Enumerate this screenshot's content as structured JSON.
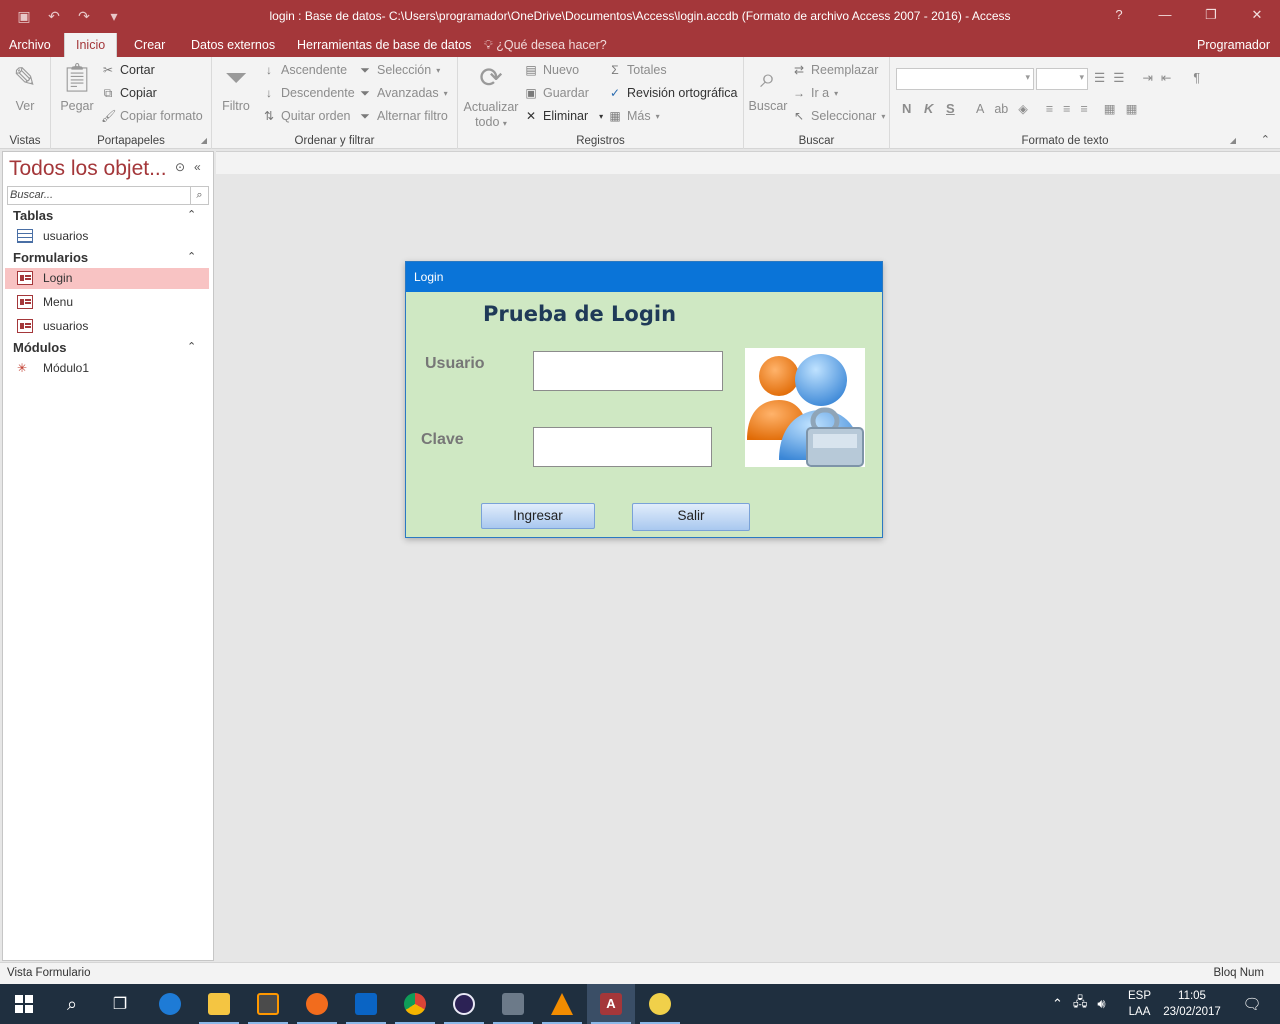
{
  "window": {
    "title": "login : Base de datos- C:\\Users\\programador\\OneDrive\\Documentos\\Access\\login.accdb (Formato de archivo Access 2007 - 2016) - Access"
  },
  "tabs": [
    "Archivo",
    "Inicio",
    "Crear",
    "Datos externos",
    "Herramientas de base de datos"
  ],
  "tell_me": "¿Qué desea hacer?",
  "user": "Programador",
  "ribbon": {
    "vistas": {
      "ver": "Ver",
      "label": "Vistas"
    },
    "portapapeles": {
      "pegar": "Pegar",
      "cortar": "Cortar",
      "copiar": "Copiar",
      "copiar_formato": "Copiar formato",
      "label": "Portapapeles"
    },
    "ordenar": {
      "filtro": "Filtro",
      "ascendente": "Ascendente",
      "descendente": "Descendente",
      "quitar_orden": "Quitar orden",
      "seleccion": "Selección",
      "avanzadas": "Avanzadas",
      "alternar_filtro": "Alternar filtro",
      "label": "Ordenar y filtrar"
    },
    "registros": {
      "actualizar": "Actualizar",
      "todo": "todo",
      "nuevo": "Nuevo",
      "guardar": "Guardar",
      "eliminar": "Eliminar",
      "totales": "Totales",
      "revision": "Revisión ortográfica",
      "mas": "Más",
      "label": "Registros"
    },
    "buscar": {
      "buscar": "Buscar",
      "reemplazar": "Reemplazar",
      "ir_a": "Ir a",
      "seleccionar": "Seleccionar",
      "label": "Buscar"
    },
    "formato": {
      "negrita": "N",
      "cursiva": "K",
      "subrayado": "S",
      "label": "Formato de texto"
    }
  },
  "nav": {
    "header": "Todos los objet...",
    "search_placeholder": "Buscar...",
    "categories": [
      {
        "name": "Tablas",
        "items": [
          "usuarios"
        ]
      },
      {
        "name": "Formularios",
        "items": [
          "Login",
          "Menu",
          "usuarios"
        ]
      },
      {
        "name": "Módulos",
        "items": [
          "Módulo1"
        ]
      }
    ]
  },
  "dialog": {
    "title": "Login",
    "heading": "Prueba de Login",
    "usuario_label": "Usuario",
    "clave_label": "Clave",
    "usuario_value": "",
    "clave_value": "",
    "btn_ingresar": "Ingresar",
    "btn_salir": "Salir"
  },
  "status": {
    "left": "Vista Formulario",
    "right": "Bloq Num"
  },
  "taskbar": {
    "lang": "ESP",
    "region": "LAA",
    "time": "11:05",
    "date": "23/02/2017"
  }
}
